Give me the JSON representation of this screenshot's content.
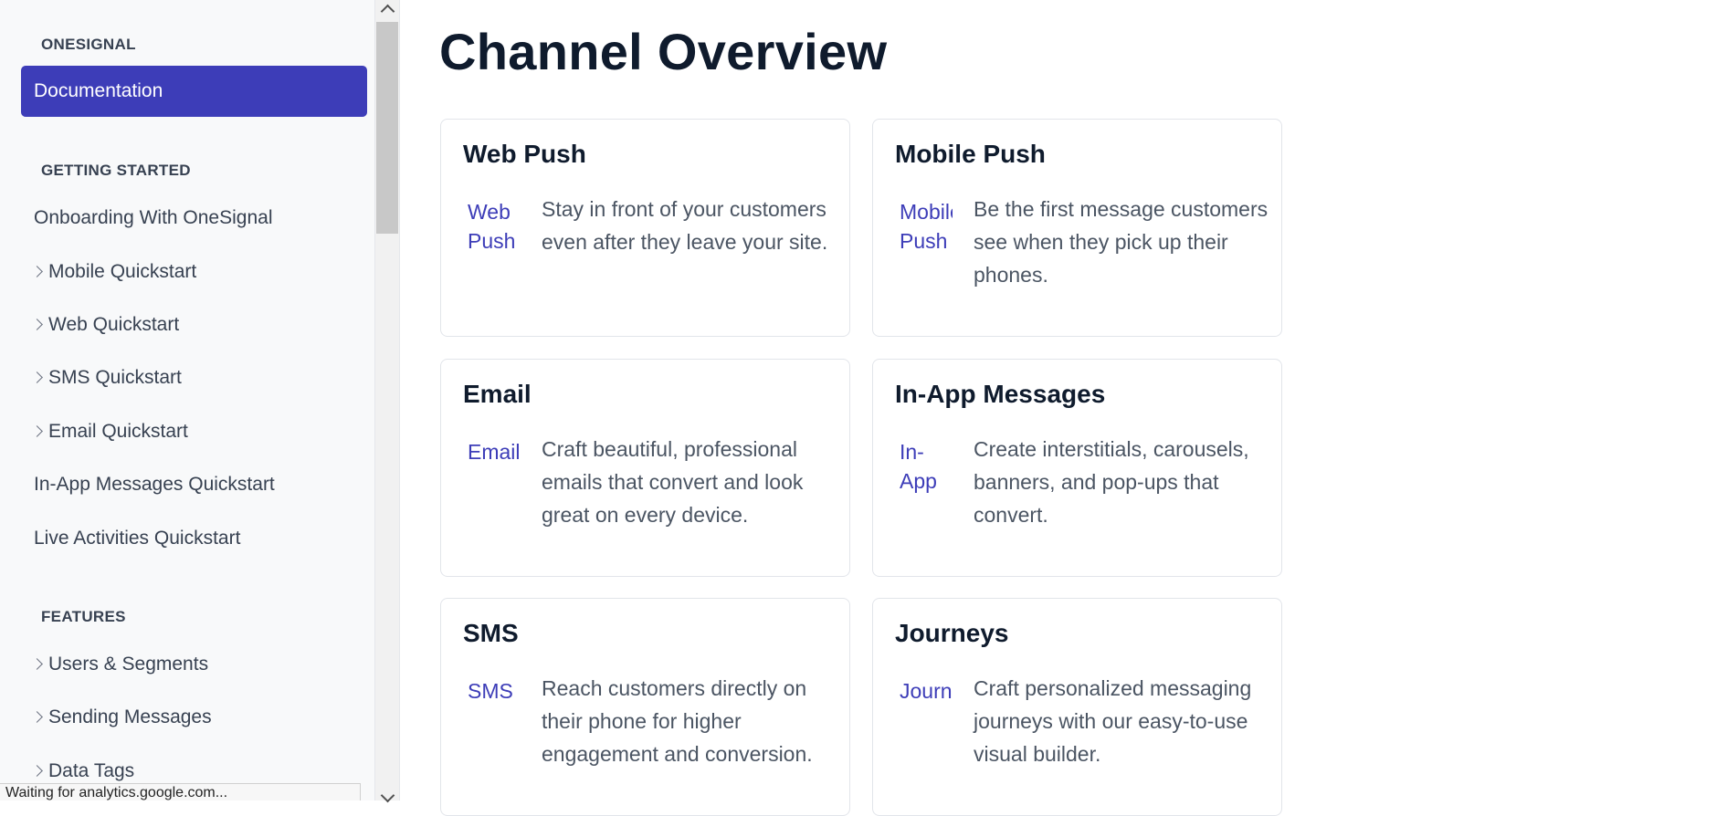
{
  "sidebar": {
    "section_onesignal": "ONESIGNAL",
    "active_item": "Documentation",
    "section_getting_started": "GETTING STARTED",
    "getting_started_items": [
      {
        "label": "Onboarding With OneSignal",
        "expandable": false
      },
      {
        "label": "Mobile Quickstart",
        "expandable": true
      },
      {
        "label": "Web Quickstart",
        "expandable": true
      },
      {
        "label": "SMS Quickstart",
        "expandable": true
      },
      {
        "label": "Email Quickstart",
        "expandable": true
      },
      {
        "label": "In-App Messages Quickstart",
        "expandable": false
      },
      {
        "label": "Live Activities Quickstart",
        "expandable": false
      }
    ],
    "section_features": "FEATURES",
    "features_items": [
      {
        "label": "Users & Segments",
        "expandable": true
      },
      {
        "label": "Sending Messages",
        "expandable": true
      },
      {
        "label": "Data Tags",
        "expandable": true
      }
    ]
  },
  "status_bar": "Waiting for analytics.google.com...",
  "main": {
    "title": "Channel Overview",
    "cards": [
      {
        "title": "Web Push",
        "icon_alt": "Web Push",
        "description": "Stay in front of your customers even after they leave your site."
      },
      {
        "title": "Mobile Push",
        "icon_alt": "Mobile Push",
        "description": "Be the first message customers see when they pick up their phones."
      },
      {
        "title": "Email",
        "icon_alt": "Email",
        "description": "Craft beautiful, professional emails that convert and look great on every device."
      },
      {
        "title": "In-App Messages",
        "icon_alt": "In-App Messages",
        "description": "Create interstitials, carousels, banners, and pop-ups that convert."
      },
      {
        "title": "SMS",
        "icon_alt": "SMS",
        "description": "Reach customers directly on their phone for higher engagement and conversion."
      },
      {
        "title": "Journeys",
        "icon_alt": "Journeys",
        "description": "Craft personalized messaging journeys with our easy-to-use visual builder."
      }
    ]
  },
  "colors": {
    "accent": "#3d3db8",
    "heading": "#0f1b2d",
    "body_text": "#4b5563",
    "sidebar_bg": "#f8f9fa"
  }
}
